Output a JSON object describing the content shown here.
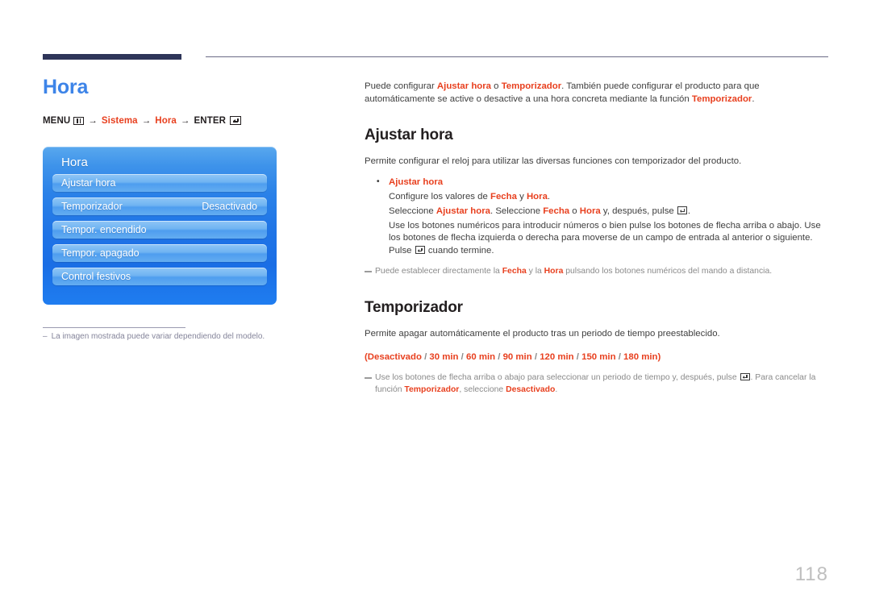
{
  "page": {
    "title": "Hora",
    "number": "118",
    "title_color": "#3d84e8",
    "accent_red": "#e8401f",
    "rule_color": "#2e3559"
  },
  "menu_path": {
    "menu_label": "MENU",
    "menu_icon": "menu-bars-icon",
    "arrow": "→",
    "item1": "Sistema",
    "item2": "Hora",
    "enter_label": "ENTER",
    "enter_icon": "enter-key-icon"
  },
  "osd": {
    "title": "Hora",
    "items": [
      {
        "label": "Ajustar hora",
        "value": ""
      },
      {
        "label": "Temporizador",
        "value": "Desactivado"
      },
      {
        "label": "Tempor. encendido",
        "value": ""
      },
      {
        "label": "Tempor. apagado",
        "value": ""
      },
      {
        "label": "Control festivos",
        "value": ""
      }
    ]
  },
  "left_footnote": {
    "dash": "–",
    "text": "La imagen mostrada puede variar dependiendo del modelo."
  },
  "intro": {
    "part1": "Puede configurar ",
    "term1": "Ajustar hora",
    "part2": " o ",
    "term2": "Temporizador",
    "part3": ". También puede configurar el producto para que automáticamente se active o desactive a una hora concreta mediante la función ",
    "term3": "Temporizador",
    "part4": "."
  },
  "ajustar_hora": {
    "heading": "Ajustar hora",
    "description": "Permite configurar el reloj para utilizar las diversas funciones con temporizador del producto.",
    "bullet_title": "Ajustar hora",
    "line1": {
      "a": "Configure los valores de ",
      "fecha": "Fecha",
      "b": " y ",
      "hora": "Hora",
      "c": "."
    },
    "line2": {
      "a": "Seleccione ",
      "ajustar": "Ajustar hora",
      "b": ". Seleccione ",
      "fecha": "Fecha",
      "c": " o ",
      "hora": "Hora",
      "d": " y, después, pulse ",
      "e": "."
    },
    "line3": {
      "a": "Use los botones numéricos para introducir números o bien pulse los botones de flecha arriba o abajo. Use los botones de flecha izquierda o derecha para moverse de un campo de entrada al anterior o siguiente. Pulse ",
      "b": " cuando termine."
    },
    "note": {
      "a": "Puede establecer directamente la ",
      "fecha": "Fecha",
      "b": " y la ",
      "hora": "Hora",
      "c": " pulsando los botones numéricos del mando a distancia."
    }
  },
  "temporizador": {
    "heading": "Temporizador",
    "description": "Permite apagar automáticamente el producto tras un periodo de tiempo preestablecido.",
    "options": [
      "Desactivado",
      "30 min",
      "60 min",
      "90 min",
      "120 min",
      "150 min",
      "180 min"
    ],
    "options_open": "(",
    "options_close": ")",
    "options_sep": " / ",
    "note": {
      "a": "Use los botones de flecha arriba o abajo para seleccionar un periodo de tiempo y, después, pulse ",
      "b": ". Para cancelar la función ",
      "temporizador": "Temporizador",
      "c": ", seleccione ",
      "desactivado": "Desactivado",
      "d": "."
    }
  }
}
